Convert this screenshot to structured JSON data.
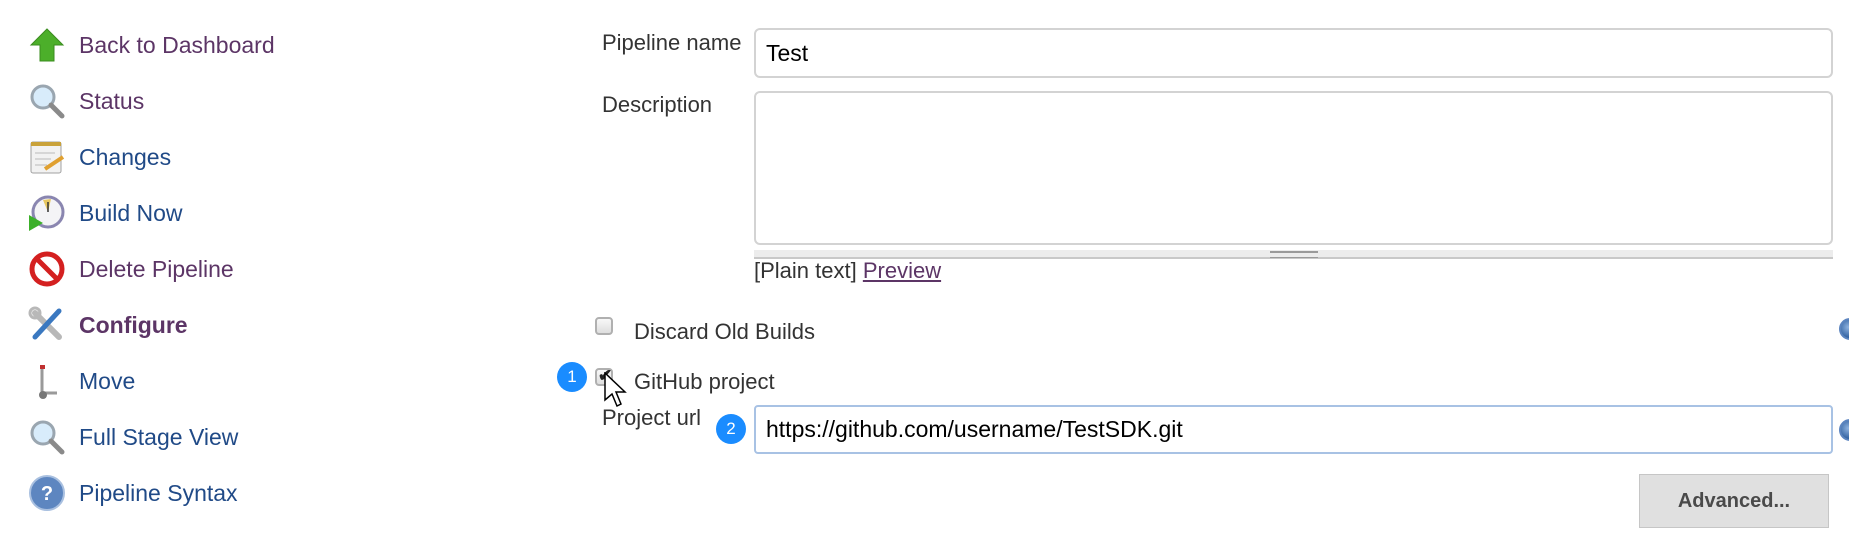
{
  "sidebar": {
    "items": [
      {
        "label": "Back to Dashboard",
        "icon": "up-arrow-icon"
      },
      {
        "label": "Status",
        "icon": "magnifier-icon"
      },
      {
        "label": "Changes",
        "icon": "notepad-icon"
      },
      {
        "label": "Build Now",
        "icon": "clock-play-icon"
      },
      {
        "label": "Delete Pipeline",
        "icon": "no-entry-icon"
      },
      {
        "label": "Configure",
        "icon": "wrench-screwdriver-icon"
      },
      {
        "label": "Move",
        "icon": "hand-truck-icon"
      },
      {
        "label": "Full Stage View",
        "icon": "magnifier-icon"
      },
      {
        "label": "Pipeline Syntax",
        "icon": "help-icon"
      }
    ]
  },
  "form": {
    "pipeline_name_label": "Pipeline name",
    "pipeline_name_value": "Test",
    "description_label": "Description",
    "description_value": "",
    "format_plain": "[Plain text]",
    "preview_link": "Preview",
    "discard_old_builds_label": "Discard Old Builds",
    "discard_old_builds_checked": false,
    "github_project_label": "GitHub project",
    "github_project_checked": true,
    "project_url_label": "Project url",
    "project_url_value": "https://github.com/username/TestSDK.git",
    "advanced_button": "Advanced..."
  },
  "annotations": {
    "badge1": "1",
    "badge2": "2",
    "badge_color": "#1a8cff"
  },
  "colors": {
    "link": "#204a87",
    "visited": "#5c3566"
  }
}
